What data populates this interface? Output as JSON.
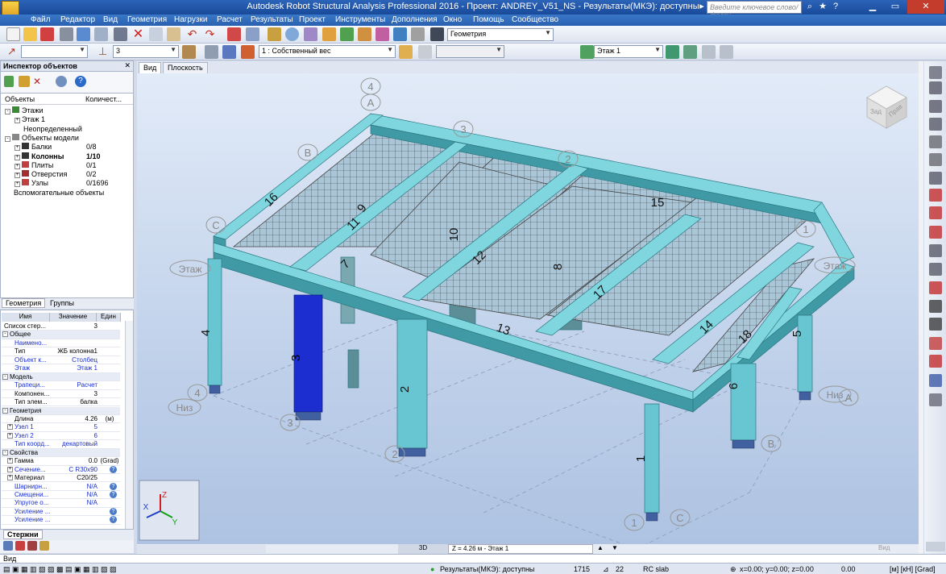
{
  "window": {
    "title": "Autodesk Robot Structural Analysis Professional 2016 - Проект: ANDREY_V51_NS - Результаты(МКЭ): доступны",
    "logo_text": "PRO",
    "search_placeholder": "Введите ключевое слово/фразу"
  },
  "menu": [
    "Файл",
    "Редактор",
    "Вид",
    "Геометрия",
    "Нагрузки",
    "Расчет",
    "Результаты",
    "Проект",
    "Инструменты",
    "Дополнения",
    "Окно",
    "Помощь",
    "Сообщество"
  ],
  "toolbar": {
    "layout_combo": "Геометрия",
    "selection_value": "3",
    "load_case": "1 : Собственный вес",
    "story_combo": "Этаж 1"
  },
  "inspector": {
    "title": "Инспектор объектов",
    "col_objects": "Объекты",
    "col_count": "Количест...",
    "tree": [
      {
        "label": "Этажи",
        "count": "",
        "level": 0,
        "pm": "-",
        "bold": false
      },
      {
        "label": "Этаж 1",
        "count": "",
        "level": 1,
        "pm": "+",
        "bold": false
      },
      {
        "label": "Неопределенный",
        "count": "",
        "level": 1,
        "pm": "",
        "bold": false
      },
      {
        "label": "Объекты модели",
        "count": "",
        "level": 0,
        "pm": "-",
        "bold": false
      },
      {
        "label": "Балки",
        "count": "0/8",
        "level": 1,
        "pm": "+",
        "bold": false
      },
      {
        "label": "Колонны",
        "count": "1/10",
        "level": 1,
        "pm": "+",
        "bold": true
      },
      {
        "label": "Плиты",
        "count": "0/1",
        "level": 1,
        "pm": "+",
        "bold": false
      },
      {
        "label": "Отверстия",
        "count": "0/2",
        "level": 1,
        "pm": "+",
        "bold": false
      },
      {
        "label": "Узлы",
        "count": "0/1696",
        "level": 1,
        "pm": "+",
        "bold": false
      },
      {
        "label": "Вспомогательные объекты",
        "count": "",
        "level": 0,
        "pm": "",
        "bold": false
      }
    ],
    "tabs": [
      "Геометрия",
      "Группы"
    ]
  },
  "properties": {
    "headers": [
      "Имя",
      "Значение",
      "Един"
    ],
    "rows": [
      {
        "type": "row",
        "name": "Список стер...",
        "value": "3",
        "unit": "",
        "blue": false,
        "indent": false
      },
      {
        "type": "sec",
        "name": "Общее"
      },
      {
        "type": "row",
        "name": "Наимено...",
        "value": "",
        "unit": "",
        "blue": true
      },
      {
        "type": "row",
        "name": "Тип",
        "value": "ЖБ колонна1",
        "unit": "",
        "blue": false
      },
      {
        "type": "row",
        "name": "Объект к...",
        "value": "Столбец",
        "unit": "",
        "blue": true
      },
      {
        "type": "row",
        "name": "Этаж",
        "value": "Этаж 1",
        "unit": "",
        "blue": true
      },
      {
        "type": "sec",
        "name": "Модель"
      },
      {
        "type": "row",
        "name": "Трапеци...",
        "value": "Расчет",
        "unit": "",
        "blue": true
      },
      {
        "type": "row",
        "name": "Компонен...",
        "value": "3",
        "unit": "",
        "blue": false
      },
      {
        "type": "row",
        "name": "Тип элем...",
        "value": "балка",
        "unit": "",
        "blue": false
      },
      {
        "type": "sec",
        "name": "Геометрия"
      },
      {
        "type": "row",
        "name": "Длина",
        "value": "4.26",
        "unit": "(м)",
        "blue": false
      },
      {
        "type": "row",
        "name": "Узел 1",
        "value": "5",
        "unit": "",
        "blue": true,
        "pm": "+"
      },
      {
        "type": "row",
        "name": "Узел 2",
        "value": "6",
        "unit": "",
        "blue": true,
        "pm": "+"
      },
      {
        "type": "row",
        "name": "Тип коорд...",
        "value": "декартовый",
        "unit": "",
        "blue": true
      },
      {
        "type": "sec",
        "name": "Свойства"
      },
      {
        "type": "row",
        "name": "Гамма",
        "value": "0.0",
        "unit": "(Grad)",
        "blue": false,
        "pm": "+"
      },
      {
        "type": "row",
        "name": "Сечение...",
        "value": "C R30x90",
        "unit": "?",
        "blue": true,
        "pm": "+"
      },
      {
        "type": "row",
        "name": "Материал",
        "value": "C20/25",
        "unit": "",
        "blue": false,
        "pm": "+"
      },
      {
        "type": "row",
        "name": "Шарнирн...",
        "value": "N/A",
        "unit": "?",
        "blue": true
      },
      {
        "type": "row",
        "name": "Смещени...",
        "value": "N/A",
        "unit": "?",
        "blue": true
      },
      {
        "type": "row",
        "name": "Упругое о...",
        "value": "N/A",
        "unit": "",
        "blue": true
      },
      {
        "type": "row",
        "name": "Усиление ...",
        "value": "",
        "unit": "?",
        "blue": true
      },
      {
        "type": "row",
        "name": "Усиление ...",
        "value": "",
        "unit": "?",
        "blue": true
      }
    ],
    "bottom_tab": "Стержни"
  },
  "view": {
    "tabs": [
      "Вид",
      "Плоскость"
    ],
    "mode": "3D",
    "z_info": "Z = 4.26 м - Этаж 1",
    "viewcube_label": "Вид",
    "cube_faces": [
      "Зад",
      "Прав"
    ],
    "axes": [
      "Z",
      "Y",
      "X"
    ],
    "grid_labels": {
      "top_num": "4",
      "top_a": "A",
      "num3": "3",
      "b_top": "B",
      "num2": "2",
      "c_left": "C",
      "num1": "1",
      "floor_left": "Этаж",
      "floor_right": "Этаж",
      "low_4": "4",
      "niz_left": "Низ",
      "low_3": "3",
      "low_2": "2",
      "low_1": "1",
      "low_c": "C",
      "low_b": "B",
      "niz_right": "Низ",
      "low_a": "A"
    },
    "members": [
      "16",
      "9",
      "11",
      "7",
      "10",
      "12",
      "8",
      "15",
      "17",
      "13",
      "14",
      "18",
      "5",
      "6",
      "4",
      "3",
      "2",
      "1"
    ]
  },
  "command_line": "Вид",
  "status": {
    "results": "Результаты(МКЭ): доступны",
    "nodes": "1715",
    "bars": "22",
    "section": "RC slab",
    "coords": "x=0.00; y=0.00; z=0.00",
    "value": "0.00",
    "units": "[м] [кН] [Grad]"
  },
  "colors": {
    "beam": "#7fd6df",
    "beam_dark": "#3f9aa6",
    "column": "#68c6d2",
    "selected": "#1c2ecf",
    "slab_grid": "#4d4d4d",
    "viewport_top": "#e2ebf8",
    "menubar": "#2a60b0"
  }
}
